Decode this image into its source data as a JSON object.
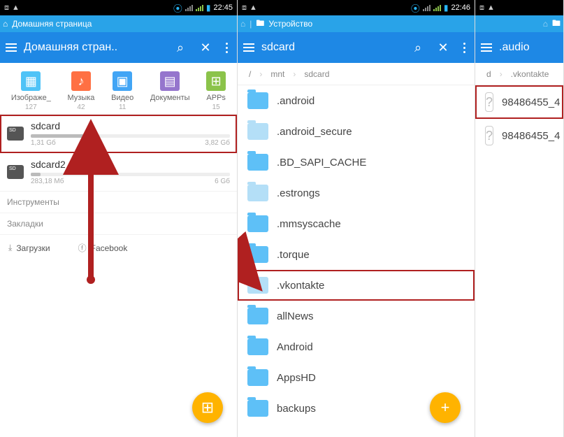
{
  "panel1": {
    "status_time": "22:45",
    "tab": "Домашняя страница",
    "header_title": "Домашняя стран..",
    "categories": [
      {
        "label": "Изображе_",
        "count": "127",
        "color": "#4fc3f7",
        "glyph": "▦"
      },
      {
        "label": "Музыка",
        "count": "42",
        "color": "#ff7043",
        "glyph": "♪"
      },
      {
        "label": "Видео",
        "count": "11",
        "color": "#42a5f5",
        "glyph": "▣"
      },
      {
        "label": "Документы",
        "count": "",
        "color": "#9575cd",
        "glyph": "▤"
      },
      {
        "label": "APPs",
        "count": "15",
        "color": "#8bc34a",
        "glyph": "⊞"
      }
    ],
    "storage": [
      {
        "name": "sdcard",
        "used": "1,31 Gб",
        "total": "3,82 Gб",
        "pct": 34,
        "hl": true
      },
      {
        "name": "sdcard2",
        "used": "283,18 Mб",
        "total": "6 Gб",
        "pct": 5,
        "hl": false
      }
    ],
    "section_tools": "Инструменты",
    "section_bookmarks": "Закладки",
    "link_downloads": "Загрузки",
    "link_fb": "Facebook"
  },
  "panel2": {
    "status_time": "22:46",
    "tab": "Устройство",
    "header_title": "sdcard",
    "breadcrumb": [
      "/",
      "mnt",
      "sdcard"
    ],
    "folders": [
      {
        "name": ".android",
        "dim": false
      },
      {
        "name": ".android_secure",
        "dim": true
      },
      {
        "name": ".BD_SAPI_CACHE",
        "dim": false
      },
      {
        "name": ".estrongs",
        "dim": true
      },
      {
        "name": ".mmsyscache",
        "dim": false
      },
      {
        "name": ".torque",
        "dim": false
      },
      {
        "name": ".vkontakte",
        "dim": true,
        "hl": true
      },
      {
        "name": "allNews",
        "dim": false
      },
      {
        "name": "Android",
        "dim": false
      },
      {
        "name": "AppsHD",
        "dim": false
      },
      {
        "name": "backups",
        "dim": false
      }
    ]
  },
  "panel3": {
    "header_title": ".audio",
    "breadcrumb_left": "d",
    "breadcrumb_right": ".vkontakte",
    "files": [
      {
        "name": "98486455_4",
        "hl": true
      },
      {
        "name": "98486455_4",
        "hl": false
      }
    ]
  }
}
